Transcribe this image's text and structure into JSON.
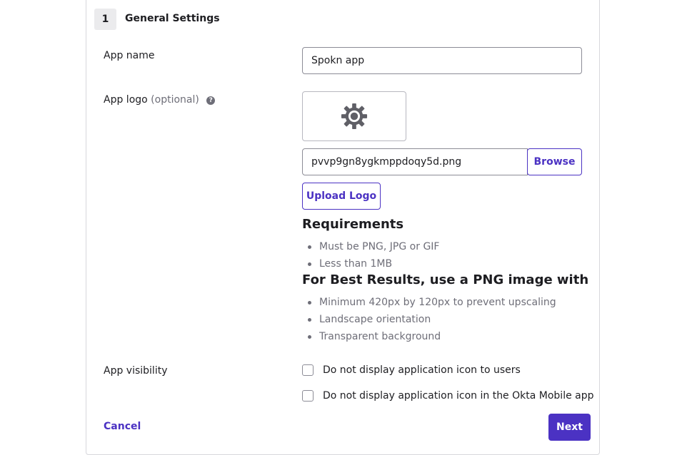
{
  "section": {
    "step_number": "1",
    "title": "General Settings"
  },
  "app_name": {
    "label": "App name",
    "value": "Spokn app"
  },
  "app_logo": {
    "label": "App logo",
    "optional": "(optional)",
    "help_glyph": "?",
    "preview_icon": "gear-icon",
    "file_value": "pvvp9gn8ygkmppdoqy5d.png",
    "browse_label": "Browse",
    "upload_label": "Upload Logo"
  },
  "requirements": {
    "heading": "Requirements",
    "items": [
      "Must be PNG, JPG or GIF",
      "Less than 1MB"
    ]
  },
  "best_results": {
    "heading": "For Best Results, use a PNG image with",
    "items": [
      "Minimum 420px by 120px to prevent upscaling",
      "Landscape orientation",
      "Transparent background"
    ]
  },
  "visibility": {
    "label": "App visibility",
    "options": [
      {
        "label": "Do not display application icon to users",
        "checked": false
      },
      {
        "label": "Do not display application icon in the Okta Mobile app",
        "checked": false
      }
    ]
  },
  "footer": {
    "cancel_label": "Cancel",
    "next_label": "Next"
  },
  "colors": {
    "accent": "#4b32c3",
    "muted_text": "#6e6e78",
    "border": "#d7d7dc"
  }
}
